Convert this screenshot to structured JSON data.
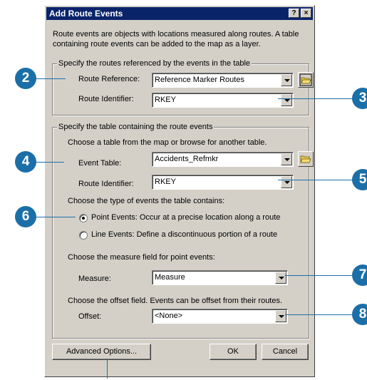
{
  "window": {
    "title": "Add Route Events",
    "help_glyph": "?",
    "close_glyph": "×"
  },
  "intro": "Route events are objects with locations measured along routes. A table containing route events can be added to the map as a layer.",
  "routes_group": {
    "legend": "Specify the routes referenced by the events in the table",
    "route_reference_label": "Route Reference:",
    "route_reference_value": "Reference Marker Routes",
    "route_identifier_label": "Route Identifier:",
    "route_identifier_value": "RKEY"
  },
  "table_group": {
    "legend": "Specify the table containing the route events",
    "choose_text": "Choose a table from the map or browse for another table.",
    "event_table_label": "Event Table:",
    "event_table_value": "Accidents_Refmkr",
    "route_identifier_label": "Route Identifier:",
    "route_identifier_value": "RKEY",
    "event_type_text": "Choose the type of events the table contains:",
    "point_events_label": "Point Events: Occur at a precise location along a route",
    "line_events_label": "Line Events: Define a discontinuous portion of a route",
    "measure_text": "Choose the measure field for point events:",
    "measure_label": "Measure:",
    "measure_value": "Measure",
    "offset_text": "Choose the offset field. Events can be offset from their routes.",
    "offset_label": "Offset:",
    "offset_value": "<None>"
  },
  "buttons": {
    "advanced": "Advanced Options...",
    "ok": "OK",
    "cancel": "Cancel"
  },
  "callouts": {
    "c2": "2",
    "c3": "3",
    "c4": "4",
    "c5": "5",
    "c6": "6",
    "c7": "7",
    "c8": "8"
  },
  "colors": {
    "titlebar": "#0a246a",
    "dialog_face": "#d4d0c8",
    "callout": "#1b6fa8"
  }
}
